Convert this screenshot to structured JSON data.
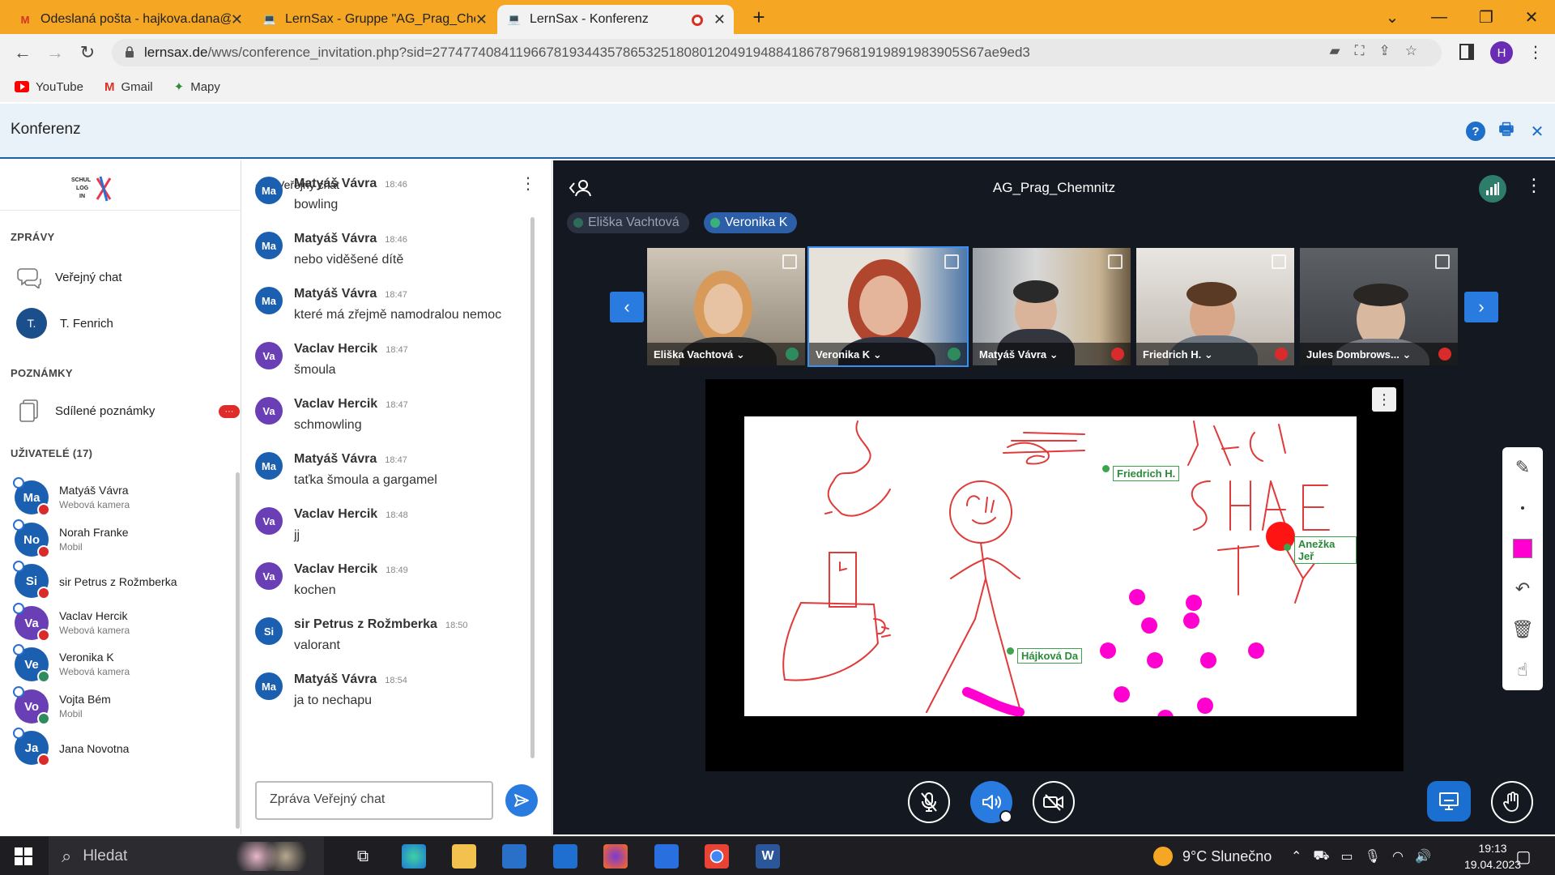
{
  "browser": {
    "tabs": [
      {
        "title": "Odeslaná pošta - hajkova.dana@",
        "icon": "gmail-icon"
      },
      {
        "title": "LernSax - Gruppe \"AG_Prag_Chem",
        "icon": "laptop-icon"
      },
      {
        "title": "LernSax - Konferenz",
        "icon": "laptop-icon"
      }
    ],
    "url_host": "lernsax.de",
    "url_path": "/wws/conference_invitation.php?sid=277477408411966781934435786532518080120491948841867879681919891983905S67ae9ed3",
    "profile_initial": "H",
    "bookmarks": [
      "YouTube",
      "Gmail",
      "Mapy"
    ]
  },
  "app": {
    "title": "Konferenz"
  },
  "sidebar": {
    "logo_text": "SCHUL LOG IN",
    "sec_messages": "ZPRÁVY",
    "public_chat": "Veřejný chat",
    "contact": {
      "initials": "T.",
      "name": "T. Fenrich"
    },
    "sec_notes": "POZNÁMKY",
    "shared_notes": "Sdílené poznámky",
    "notes_badge": "···",
    "sec_users": "UŽIVATELÉ (17)",
    "users": [
      {
        "initials": "Ma",
        "name": "Matyáš Vávra",
        "sub": "Webová kamera",
        "color": "#1b5fb0",
        "status": "muted"
      },
      {
        "initials": "No",
        "name": "Norah Franke",
        "sub": "Mobil",
        "color": "#1b5fb0",
        "status": "muted"
      },
      {
        "initials": "Si",
        "name": "sir Petrus z Rožmberka",
        "sub": "",
        "color": "#1b5fb0",
        "status": "muted"
      },
      {
        "initials": "Va",
        "name": "Vaclav Hercik",
        "sub": "Webová kamera",
        "color": "#6a3fb5",
        "status": "muted"
      },
      {
        "initials": "Ve",
        "name": "Veronika K",
        "sub": "Webová kamera",
        "color": "#1b5fb0",
        "status": "on"
      },
      {
        "initials": "Vo",
        "name": "Vojta Bém",
        "sub": "Mobil",
        "color": "#6a3fb5",
        "status": "on"
      },
      {
        "initials": "Ja",
        "name": "Jana Novotna",
        "sub": "",
        "color": "#1b5fb0",
        "status": "muted"
      }
    ]
  },
  "chat": {
    "title": "Veřejný chat",
    "messages": [
      {
        "initials": "Ma",
        "name": "Matyáš Vávra",
        "time": "18:46",
        "text": "bowling",
        "color": "#1b5fb0"
      },
      {
        "initials": "Ma",
        "name": "Matyáš Vávra",
        "time": "18:46",
        "text": "nebo viděšené dítě",
        "color": "#1b5fb0"
      },
      {
        "initials": "Ma",
        "name": "Matyáš Vávra",
        "time": "18:47",
        "text": "které má zřejmě namodralou nemoc",
        "color": "#1b5fb0"
      },
      {
        "initials": "Va",
        "name": "Vaclav Hercik",
        "time": "18:47",
        "text": "šmoula",
        "color": "#6a3fb5"
      },
      {
        "initials": "Va",
        "name": "Vaclav Hercik",
        "time": "18:47",
        "text": "schmowling",
        "color": "#6a3fb5"
      },
      {
        "initials": "Ma",
        "name": "Matyáš Vávra",
        "time": "18:47",
        "text": "taťka šmoula a gargamel",
        "color": "#1b5fb0"
      },
      {
        "initials": "Va",
        "name": "Vaclav Hercik",
        "time": "18:48",
        "text": "jj",
        "color": "#6a3fb5"
      },
      {
        "initials": "Va",
        "name": "Vaclav Hercik",
        "time": "18:49",
        "text": "kochen",
        "color": "#6a3fb5"
      },
      {
        "initials": "Si",
        "name": "sir Petrus z Rožmberka",
        "time": "18:50",
        "text": "valorant",
        "color": "#1b5fb0"
      },
      {
        "initials": "Ma",
        "name": "Matyáš Vávra",
        "time": "18:54",
        "text": "ja to nechapu",
        "color": "#1b5fb0"
      }
    ],
    "input_placeholder": "Zpráva Veřejný chat"
  },
  "conference": {
    "title": "AG_Prag_Chemnitz",
    "speakers": [
      "Eliška Vachtová",
      "Veronika K"
    ],
    "videos": [
      {
        "name": "Eliška Vachtová",
        "mic": "on"
      },
      {
        "name": "Veronika K",
        "mic": "on"
      },
      {
        "name": "Matyáš Vávra",
        "mic": "muted"
      },
      {
        "name": "Friedrich H.",
        "mic": "muted"
      },
      {
        "name": "Jules Dombrows...",
        "mic": "muted"
      }
    ],
    "cursors": [
      "Friedrich H.",
      "Anežka Jeř",
      "Hájková Da"
    ]
  },
  "taskbar": {
    "search": "Hledat",
    "weather": "9°C Slunečno",
    "time": "19:13",
    "date": "19.04.2023"
  }
}
